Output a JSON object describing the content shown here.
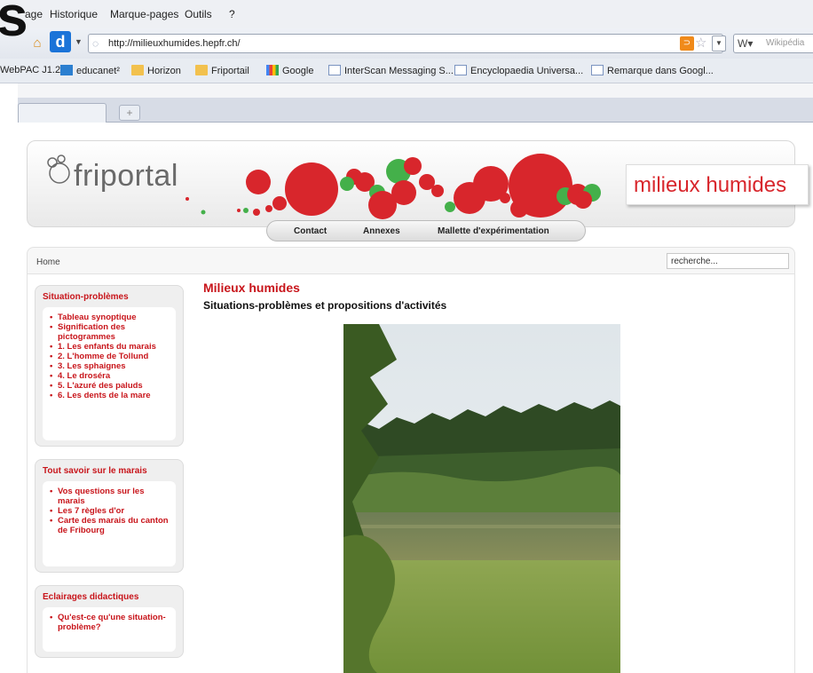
{
  "window": {
    "title_fragment": "s"
  },
  "menu": {
    "items": [
      "age",
      "Historique",
      "Marque-pages",
      "Outils",
      "?"
    ]
  },
  "navbar": {
    "url": "http://milieuxhumides.hepfr.ch/",
    "search_placeholder": "Wikipédia",
    "icons": [
      "home-icon",
      "ext-icon",
      "rss-icon",
      "star-icon",
      "wikipedia-icon"
    ]
  },
  "bookmarks": [
    {
      "label": "WebPAC J1.2",
      "icon": "none"
    },
    {
      "label": "educanet²",
      "icon": "edu"
    },
    {
      "label": "Horizon",
      "icon": "folder"
    },
    {
      "label": "Friportail",
      "icon": "folder"
    },
    {
      "label": "Google",
      "icon": "google"
    },
    {
      "label": "InterScan Messaging S...",
      "icon": "page"
    },
    {
      "label": "Encyclopaedia Universa...",
      "icon": "page"
    },
    {
      "label": "Remarque dans Googl...",
      "icon": "page"
    }
  ],
  "tabs": {
    "new_tab_label": "+"
  },
  "site": {
    "logo": "friportal",
    "header_title": "milieux humides",
    "colors": {
      "accent_red": "#d8262c",
      "link_red": "#c8151b",
      "green": "#44b04a"
    },
    "topnav": [
      "Contact",
      "Annexes",
      "Mallette d'expérimentation"
    ],
    "breadcrumb": "Home",
    "search_value": "recherche...",
    "sidebar": [
      {
        "title": "Situation-problèmes",
        "items": [
          "Tableau synoptique",
          "Signification des pictogrammes",
          "1. Les enfants du marais",
          "2. L'homme de Tollund",
          "3. Les sphaignes",
          "4. Le droséra",
          "5. L'azuré des paluds",
          "6. Les dents de la mare"
        ]
      },
      {
        "title": "Tout savoir sur le marais",
        "items": [
          "Vos questions sur les marais",
          "Les 7 règles d'or",
          "Carte des marais du canton de Fribourg"
        ]
      },
      {
        "title": "Eclairages didactiques",
        "items": [
          "Qu'est-ce qu'une situation-problème?"
        ]
      }
    ],
    "content": {
      "title": "Milieux humides",
      "subtitle": "Situations-problèmes et propositions d'activités"
    }
  }
}
